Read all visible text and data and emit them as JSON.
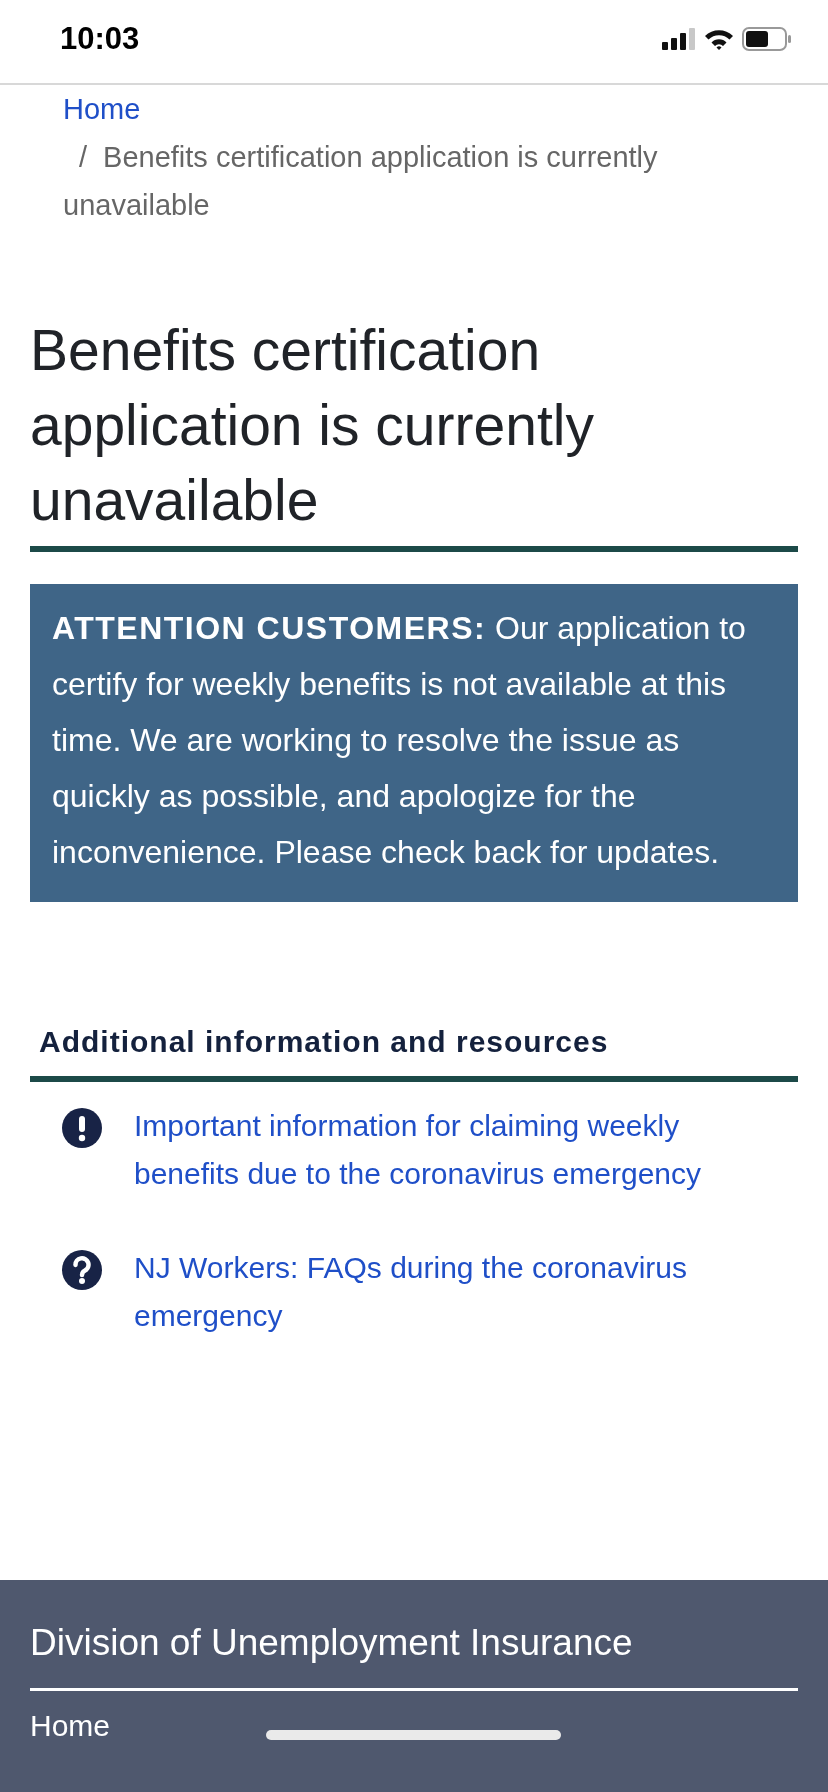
{
  "status_bar": {
    "time": "10:03"
  },
  "breadcrumb": {
    "home": "Home",
    "separator": "/",
    "current": "Benefits certification application is currently unavailable"
  },
  "title": "Benefits certification application is currently unavailable",
  "alert": {
    "text": "**ATTENTION CUSTOMERS:** Our application to certify for weekly benefits is not available at this time. We are working to resolve the issue as quickly as possible, and apologize for the inconvenience. Please check back for updates."
  },
  "resources": {
    "heading": "Additional information and resources",
    "links": [
      {
        "kind": "important",
        "text": "Important information for claiming weekly benefits due to the coronavirus emergency"
      },
      {
        "kind": "faq",
        "text": "NJ Workers: FAQs during the coronavirus emergency"
      }
    ]
  },
  "footer": {
    "title": "Division of Unemployment Insurance",
    "links": [
      "Home"
    ]
  }
}
